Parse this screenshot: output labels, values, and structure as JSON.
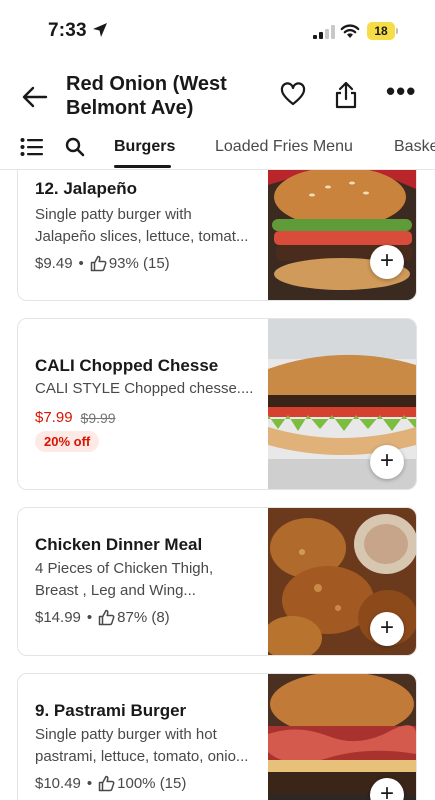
{
  "status": {
    "time": "7:33",
    "battery": "18"
  },
  "header": {
    "title_line1": "Red Onion (West",
    "title_line2": "Belmont Ave)"
  },
  "tabs": [
    {
      "label": "Burgers",
      "active": true
    },
    {
      "label": "Loaded Fries Menu",
      "active": false
    },
    {
      "label": "Baske",
      "active": false
    }
  ],
  "items": [
    {
      "name": "12. Jalapeño",
      "desc_line1": "Single patty burger with",
      "desc_line2": "Jalapeño slices, lettuce, tomat...",
      "price": "$9.49",
      "rating": "93% (15)",
      "image_icon": "burger-photo"
    },
    {
      "name": "CALI Chopped Chesse",
      "desc_line1": "CALI STYLE Chopped chesse....",
      "price": "$7.99",
      "old_price": "$9.99",
      "promo": "20% off",
      "image_icon": "sandwich-photo"
    },
    {
      "name": "Chicken Dinner Meal",
      "desc_line1": "4 Pieces of Chicken Thigh,",
      "desc_line2": "Breast , Leg and Wing...",
      "price": "$14.99",
      "rating": "87% (8)",
      "image_icon": "fried-chicken-photo"
    },
    {
      "name": "9. Pastrami Burger",
      "desc_line1": "Single patty burger with hot",
      "desc_line2": "pastrami, lettuce, tomato, onio...",
      "price": "$10.49",
      "rating": "100% (15)",
      "image_icon": "pastrami-burger-photo"
    }
  ],
  "add_label": "+",
  "colors": {
    "sale_red": "#d91400",
    "promo_bg": "#fde9e6",
    "battery_yellow": "#f6dc45"
  }
}
